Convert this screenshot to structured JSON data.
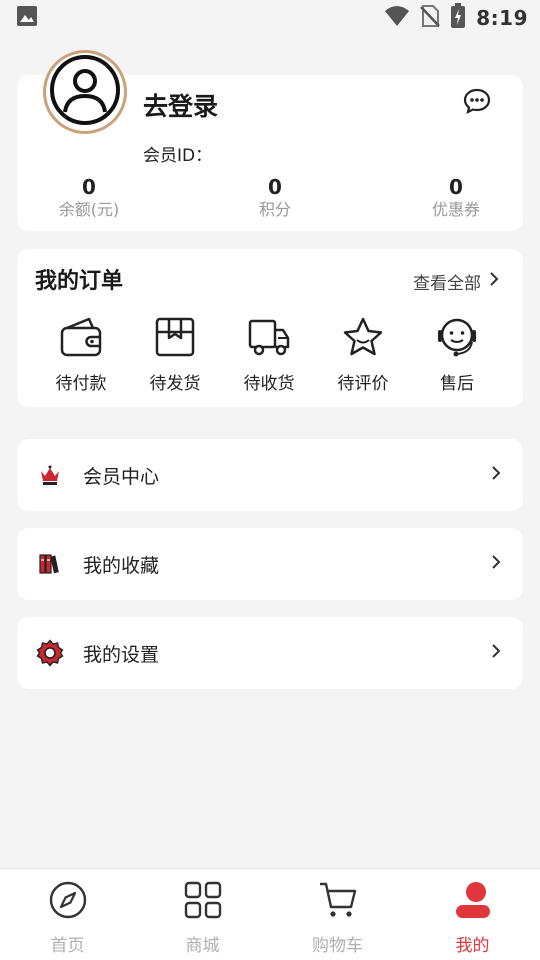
{
  "status_bar": {
    "time": "8:19",
    "icons": [
      "image-icon",
      "wifi-icon",
      "no-sim-icon",
      "battery-charging-icon"
    ]
  },
  "profile": {
    "login_label": "去登录",
    "member_id_label": "会员ID：",
    "avatar_icon": "user-avatar-icon",
    "message_icon": "chat-bubble-icon",
    "stats": [
      {
        "value": "0",
        "label": "余额(元)"
      },
      {
        "value": "0",
        "label": "积分"
      },
      {
        "value": "0",
        "label": "优惠券"
      }
    ]
  },
  "orders": {
    "title": "我的订单",
    "view_all": "查看全部",
    "items": [
      {
        "label": "待付款",
        "icon": "wallet-icon"
      },
      {
        "label": "待发货",
        "icon": "box-icon"
      },
      {
        "label": "待收货",
        "icon": "truck-icon"
      },
      {
        "label": "待评价",
        "icon": "star-icon"
      },
      {
        "label": "售后",
        "icon": "headset-icon"
      }
    ]
  },
  "menu": [
    {
      "label": "会员中心",
      "icon": "crown-icon"
    },
    {
      "label": "我的收藏",
      "icon": "books-icon"
    },
    {
      "label": "我的设置",
      "icon": "gear-icon"
    }
  ],
  "bottom_nav": {
    "active_index": 3,
    "items": [
      {
        "label": "首页",
        "icon": "compass-icon"
      },
      {
        "label": "商城",
        "icon": "grid-icon"
      },
      {
        "label": "购物车",
        "icon": "cart-icon"
      },
      {
        "label": "我的",
        "icon": "person-icon"
      }
    ]
  },
  "colors": {
    "accent": "#e0373f",
    "avatar_ring": "#c9a27a",
    "background": "#f4f4f4"
  }
}
